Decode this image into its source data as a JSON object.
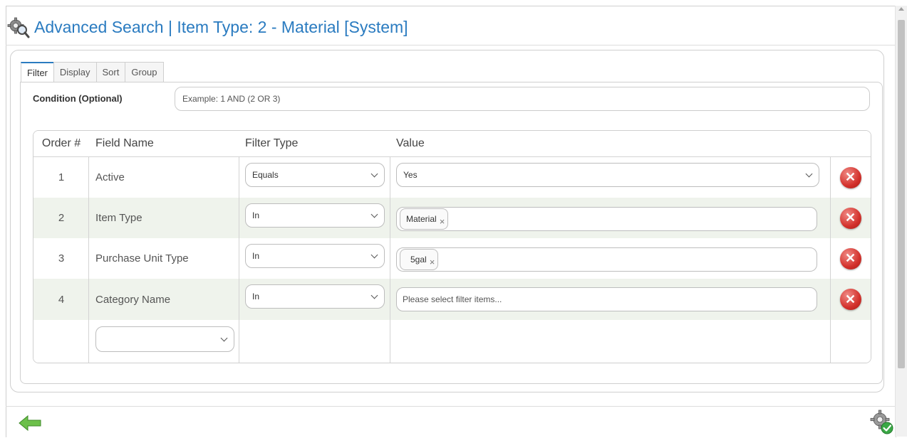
{
  "title": "Advanced Search | Item Type: 2 - Material [System]",
  "tabs": [
    "Filter",
    "Display",
    "Sort",
    "Group"
  ],
  "condition": {
    "label": "Condition (Optional)",
    "placeholder": "Example: 1 AND (2 OR 3)"
  },
  "grid": {
    "headers": {
      "order": "Order #",
      "field": "Field Name",
      "filter_type": "Filter Type",
      "value": "Value"
    },
    "rows": [
      {
        "order": "1",
        "field": "Active",
        "filter_type": "Equals",
        "value_select": "Yes"
      },
      {
        "order": "2",
        "field": "Item Type",
        "filter_type": "In",
        "chip": "Material"
      },
      {
        "order": "3",
        "field": "Purchase Unit Type",
        "filter_type": "In",
        "chip": "5gal"
      },
      {
        "order": "4",
        "field": "Category Name",
        "filter_type": "In",
        "placeholder": "Please select filter items..."
      }
    ]
  },
  "chip_remove_glyph": "×",
  "delete_glyph": "✕",
  "colors": {
    "accent": "#2a7bc0",
    "alt_row": "#eff3ec",
    "delete": "#d3312c",
    "back_arrow": "#6cc04a"
  }
}
